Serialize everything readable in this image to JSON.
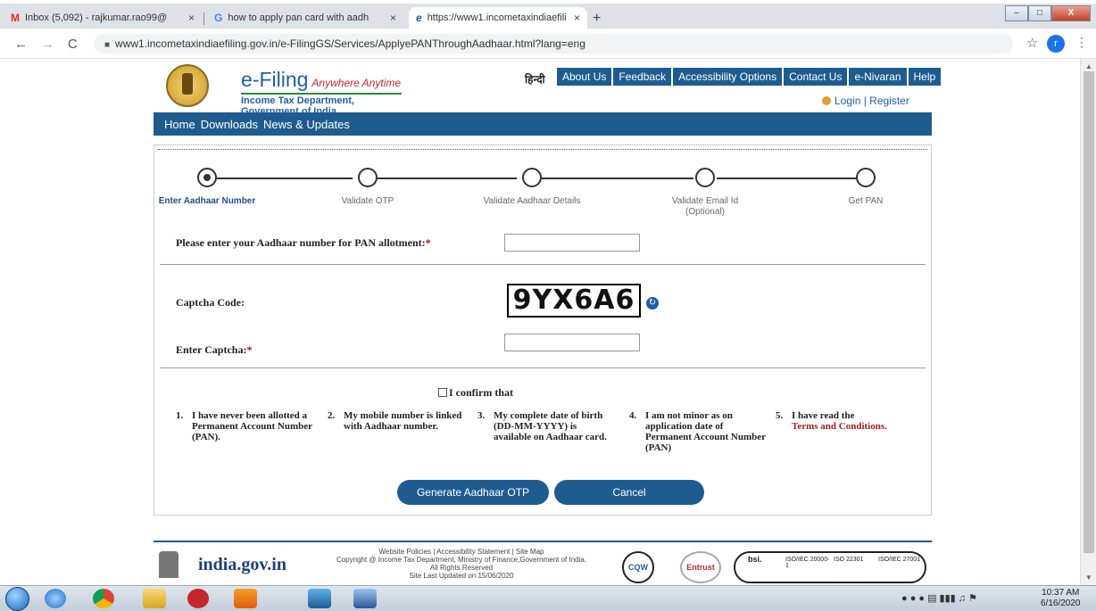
{
  "browser": {
    "tabs": [
      {
        "icon": "M",
        "title": "Inbox (5,092) - rajkumar.rao99@",
        "close": "×"
      },
      {
        "icon": "G",
        "title": "how to apply pan card with aadh",
        "close": "×"
      },
      {
        "icon": "e",
        "title": "https://www1.incometaxindiaefili",
        "close": "×"
      }
    ],
    "new_tab": "+",
    "window_controls": {
      "minimize": "–",
      "maximize": "□",
      "close": "X"
    },
    "back": "←",
    "forward": "→",
    "reload": "C",
    "url": "www1.incometaxindiaefiling.gov.in/e-FilingGS/Services/ApplyePANThroughAadhaar.html?lang=eng",
    "avatar_letter": "r",
    "bookmark_star": "☆",
    "menu": "⋮"
  },
  "site": {
    "brand": "e-Filing",
    "tagline": "Anywhere Anytime",
    "subtitle": "Income Tax Department, Government of India",
    "hindi": "हिन्दी",
    "topnav": [
      "About Us",
      "Feedback",
      "Accessibility Options",
      "Contact Us",
      "e-Nivaran",
      "Help"
    ],
    "login": "Login | Register",
    "mainnav": [
      "Home",
      "Downloads",
      "News & Updates"
    ]
  },
  "steps": [
    {
      "label": "Enter Aadhaar Number",
      "active": true
    },
    {
      "label": "Validate OTP",
      "active": false
    },
    {
      "label": "Validate Aadhaar Details",
      "active": false
    },
    {
      "label": "Validate Email Id (Optional)",
      "active": false
    },
    {
      "label": "Get PAN",
      "active": false
    }
  ],
  "form": {
    "aadhaar_label": "Please enter your Aadhaar number for PAN allotment:",
    "required_mark": "*",
    "aadhaar_value": "",
    "captcha_label": "Captcha Code:",
    "captcha_text": "9YX6A6",
    "enter_captcha_label": "Enter Captcha:",
    "captcha_value": "",
    "confirm_label": "I confirm that",
    "conditions": [
      {
        "num": "1.",
        "lines": [
          "I have never been allotted a",
          "Permanent Account Number",
          "(PAN)."
        ]
      },
      {
        "num": "2.",
        "lines": [
          "My mobile number is linked",
          "with Aadhaar number."
        ]
      },
      {
        "num": "3.",
        "lines": [
          "My complete date of birth",
          "(DD-MM-YYYY) is",
          "available on Aadhaar card."
        ]
      },
      {
        "num": "4.",
        "lines": [
          "I am not minor as on",
          "application date of",
          "Permanent Account Number",
          "(PAN)"
        ]
      },
      {
        "num": "5.",
        "lines": [
          "I have read the",
          "Terms and Conditions."
        ]
      }
    ],
    "generate_button": "Generate Aadhaar OTP",
    "cancel_button": "Cancel"
  },
  "footer": {
    "indiagov": "india.gov.in",
    "links": "Website Policies | Accessibility Statement | Site Map",
    "copyright": "Copyright @ Income Tax Department, Ministry of Finance,Government of India.",
    "rights": "All Rights Reserved",
    "updated": "Site Last Updated on 15/06/2020",
    "badges": [
      "CQW",
      "Entrust",
      "bsi.",
      "ISO/IEC 20000-1",
      "ISO 22301",
      "ISO/IEC 27001"
    ]
  },
  "taskbar": {
    "time": "10:37 AM",
    "date": "6/16/2020"
  }
}
